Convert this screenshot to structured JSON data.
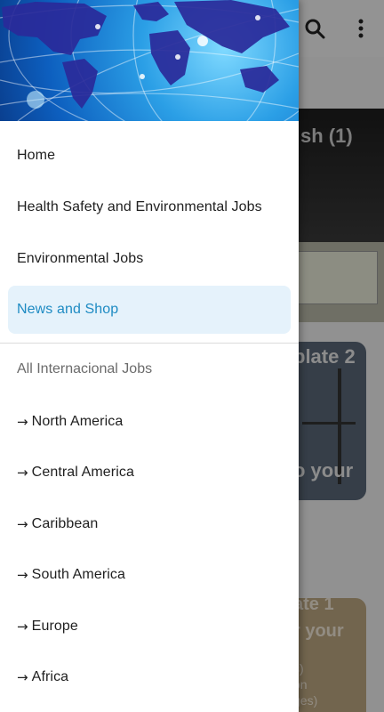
{
  "background": {
    "card1_title": "sh (1)",
    "card2_title": "plate 2",
    "card2_subtitle": "o your",
    "card3_title": "ate 1",
    "card3_subtitle": "r your",
    "card3_lines": [
      "s)",
      "on",
      "ges)"
    ]
  },
  "drawer": {
    "items": [
      {
        "label": "Home",
        "active": false
      },
      {
        "label": "Health Safety and Environmental Jobs",
        "active": false
      },
      {
        "label": "Environmental Jobs",
        "active": false
      },
      {
        "label": "News and Shop",
        "active": true
      }
    ],
    "section_label": "All Internacional Jobs",
    "regions": [
      {
        "arrow": "→",
        "label": "North America"
      },
      {
        "arrow": "→",
        "label": "Central America"
      },
      {
        "arrow": "→",
        "label": "Caribbean"
      },
      {
        "arrow": "→",
        "label": "South America"
      },
      {
        "arrow": "→",
        "label": "Europe"
      },
      {
        "arrow": "→",
        "label": "Africa"
      }
    ]
  },
  "colors": {
    "active_text": "#1e8bc3",
    "active_bg": "#e5f2fb"
  }
}
